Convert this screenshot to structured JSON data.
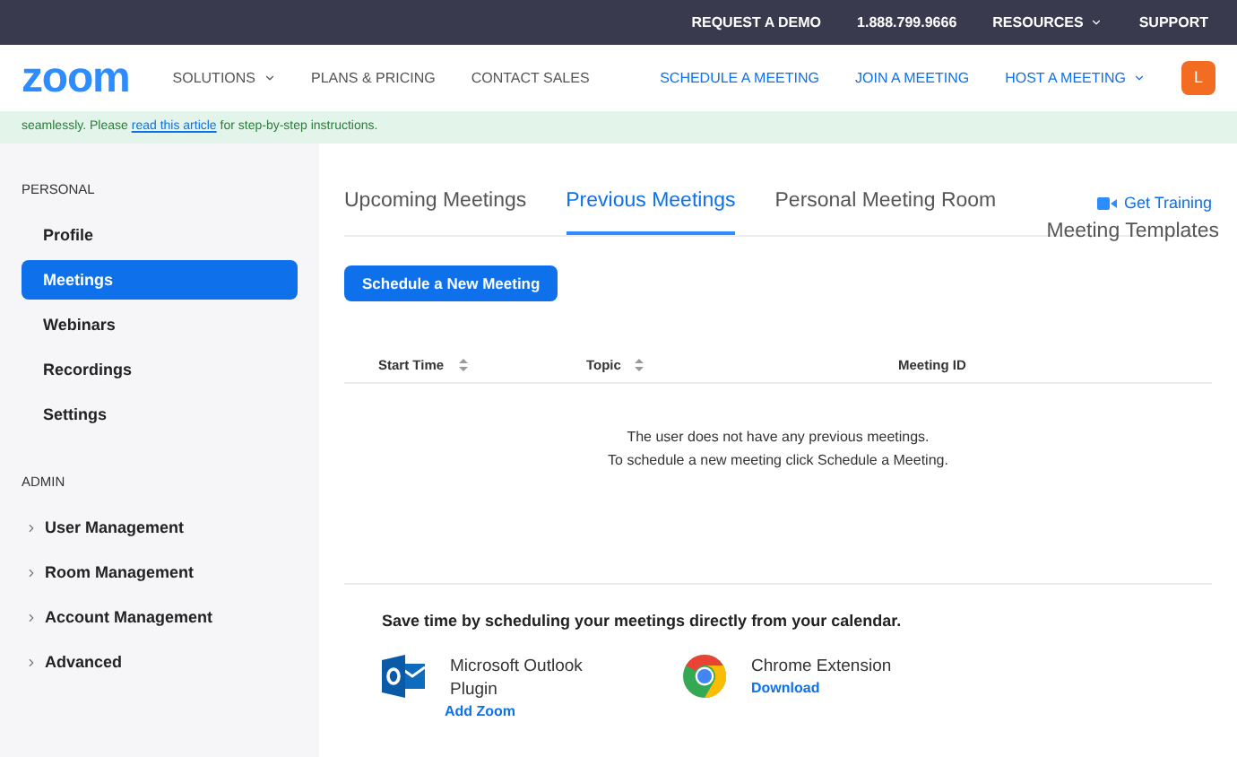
{
  "top_bar": {
    "links": [
      "REQUEST A DEMO",
      "1.888.799.9666",
      "RESOURCES",
      "SUPPORT"
    ]
  },
  "header": {
    "logo": "zoom",
    "nav": [
      {
        "label": "SOLUTIONS",
        "dropdown": true
      },
      {
        "label": "PLANS & PRICING",
        "dropdown": false
      },
      {
        "label": "CONTACT SALES",
        "dropdown": false
      }
    ],
    "actions": [
      {
        "label": "SCHEDULE A MEETING",
        "dropdown": false
      },
      {
        "label": "JOIN A MEETING",
        "dropdown": false
      },
      {
        "label": "HOST A MEETING",
        "dropdown": true
      }
    ],
    "avatar": "L"
  },
  "banner": {
    "before": "seamlessly. Please",
    "link": "read this article",
    "after": "for step-by-step instructions."
  },
  "sidebar": {
    "sections": [
      {
        "title": "PERSONAL",
        "items": [
          {
            "label": "Profile",
            "selected": false,
            "expandable": false
          },
          {
            "label": "Meetings",
            "selected": true,
            "expandable": false
          },
          {
            "label": "Webinars",
            "selected": false,
            "expandable": false
          },
          {
            "label": "Recordings",
            "selected": false,
            "expandable": false
          },
          {
            "label": "Settings",
            "selected": false,
            "expandable": false
          }
        ]
      },
      {
        "title": "ADMIN",
        "items": [
          {
            "label": "User Management",
            "selected": false,
            "expandable": true
          },
          {
            "label": "Room Management",
            "selected": false,
            "expandable": true
          },
          {
            "label": "Account Management",
            "selected": false,
            "expandable": true
          },
          {
            "label": "Advanced",
            "selected": false,
            "expandable": true
          }
        ]
      }
    ]
  },
  "tabs": [
    {
      "label": "Upcoming Meetings",
      "selected": false
    },
    {
      "label": "Previous Meetings",
      "selected": true
    },
    {
      "label": "Personal Meeting Room",
      "selected": false
    }
  ],
  "get_training": "Get Training",
  "templates": "Meeting Templates",
  "schedule_button": "Schedule a New Meeting",
  "table": {
    "columns": [
      {
        "label": "Start Time",
        "sortable": true
      },
      {
        "label": "Topic",
        "sortable": true
      },
      {
        "label": "Meeting ID",
        "sortable": false
      }
    ],
    "empty": [
      "The user does not have any previous meetings.",
      "To schedule a new meeting click Schedule a Meeting."
    ]
  },
  "calendar": {
    "title": "Save time by scheduling your meetings directly from your calendar.",
    "integrations": [
      {
        "kind": "outlook",
        "name": "Microsoft Outlook Plugin",
        "action": "Add Zoom"
      },
      {
        "kind": "chrome",
        "name": "Chrome Extension",
        "action": "Download"
      }
    ]
  }
}
